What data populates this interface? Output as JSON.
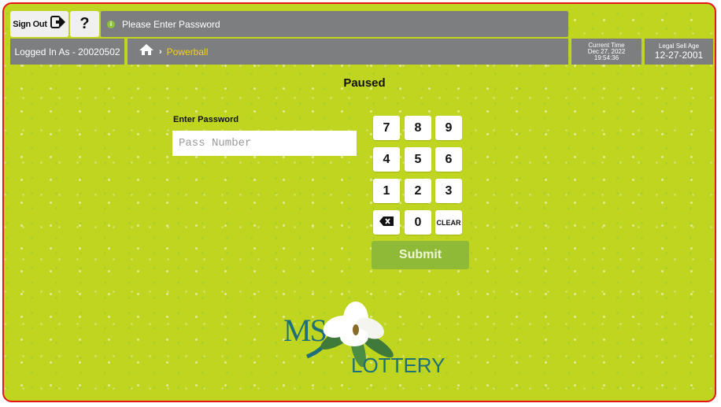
{
  "header": {
    "sign_out_label": "Sign Out",
    "help_label": "?",
    "message": "Please Enter Password",
    "logged_in": "Logged In As - 20020502",
    "breadcrumb": "Powerball",
    "current_time_title": "Current Time",
    "current_date": "Dec 27, 2022",
    "current_time": "19:54:36",
    "legal_age_title": "Legal Sell Age",
    "legal_age_value": "12-27-2001"
  },
  "main": {
    "status": "Paused",
    "password_label": "Enter Password",
    "password_placeholder": "Pass Number",
    "keypad": [
      "7",
      "8",
      "9",
      "4",
      "5",
      "6",
      "1",
      "2",
      "3",
      "⌫",
      "0",
      "CLEAR"
    ],
    "submit_label": "Submit"
  },
  "logo": {
    "ms": "MS",
    "lottery": "LOTTERY"
  },
  "colors": {
    "background": "#c0d51f",
    "bar": "#7d7e80",
    "border": "#e8151b",
    "submit": "#8fba37",
    "breadcrumb": "#f6d11a"
  },
  "icons": {
    "sign_out": "sign-out-arrow-icon",
    "home": "home-icon",
    "info": "info-icon",
    "backspace": "backspace-icon"
  }
}
